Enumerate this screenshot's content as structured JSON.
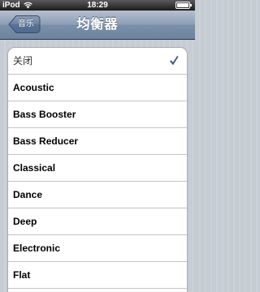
{
  "status_bar": {
    "carrier": "iPod",
    "time": "18:29",
    "wifi_icon": "wifi-icon",
    "battery_icon": "battery-icon"
  },
  "nav_bar": {
    "back_label": "音乐",
    "title": "均衡器"
  },
  "equalizer_list": {
    "selected_index": 0,
    "check_icon": "checkmark-icon",
    "items": [
      {
        "label": "关闭",
        "selected": true
      },
      {
        "label": "Acoustic",
        "selected": false
      },
      {
        "label": "Bass Booster",
        "selected": false
      },
      {
        "label": "Bass Reducer",
        "selected": false
      },
      {
        "label": "Classical",
        "selected": false
      },
      {
        "label": "Dance",
        "selected": false
      },
      {
        "label": "Deep",
        "selected": false
      },
      {
        "label": "Electronic",
        "selected": false
      },
      {
        "label": "Flat",
        "selected": false
      }
    ]
  },
  "colors": {
    "nav_bar": "#7b8fa8",
    "background": "#c5ccd4",
    "checkmark": "#3d5488"
  }
}
